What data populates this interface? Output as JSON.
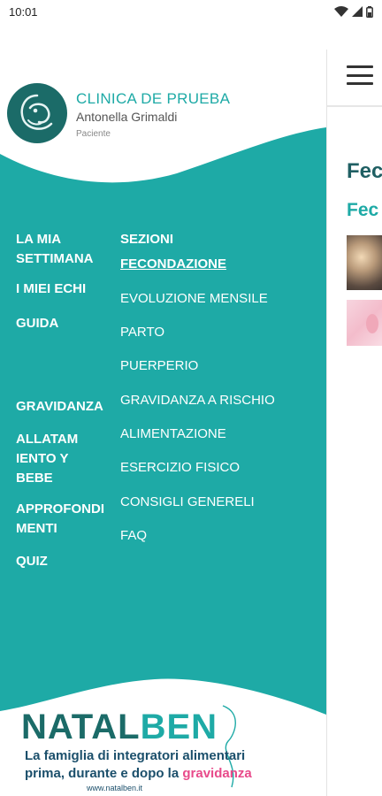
{
  "status_bar": {
    "time": "10:01",
    "icons": [
      "wifi-icon",
      "signal-icon",
      "battery-icon"
    ]
  },
  "background_page": {
    "title": "Fec",
    "subtitle": "Fec",
    "icons": [
      "hamburger-menu-icon"
    ]
  },
  "drawer": {
    "header": {
      "clinic_name": "CLINICA DE PRUEBA",
      "user_name": "Antonella Grimaldi",
      "user_role": "Paciente",
      "logo_icon": "clinic-logo-icon"
    },
    "nav_left": [
      {
        "label": "LA MIA\nSETTIMANA"
      },
      {
        "label": "I MIEI ECHI"
      },
      {
        "label": "GUIDA"
      },
      {
        "label": "GRAVIDANZA"
      },
      {
        "label": "ALLATAM\nIENTO Y\nBEBE"
      },
      {
        "label": "APPROFONDI\nMENTI"
      },
      {
        "label": "QUIZ"
      }
    ],
    "nav_right": {
      "header": "SEZIONI",
      "items": [
        {
          "label": "FECONDAZIONE",
          "active": true
        },
        {
          "label": "EVOLUZIONE MENSILE"
        },
        {
          "label": "PARTO"
        },
        {
          "label": "PUERPERIO"
        },
        {
          "label": "GRAVIDANZA A RISCHIO"
        },
        {
          "label": "ALIMENTAZIONE"
        },
        {
          "label": "ESERCIZIO FISICO"
        },
        {
          "label": "CONSIGLI GENERELI"
        },
        {
          "label": "FAQ"
        }
      ]
    },
    "ad": {
      "brand_part1": "NATAL",
      "brand_part2": "BEN",
      "line1": "La famiglia di integratori alimentari",
      "line2_prefix": "prima, durante e dopo la ",
      "line2_highlight": "gravidanza",
      "url": "www.natalben.it"
    }
  },
  "colors": {
    "teal": "#1eaaa6",
    "dark_teal": "#1b6b68",
    "pink": "#e84a8a"
  }
}
